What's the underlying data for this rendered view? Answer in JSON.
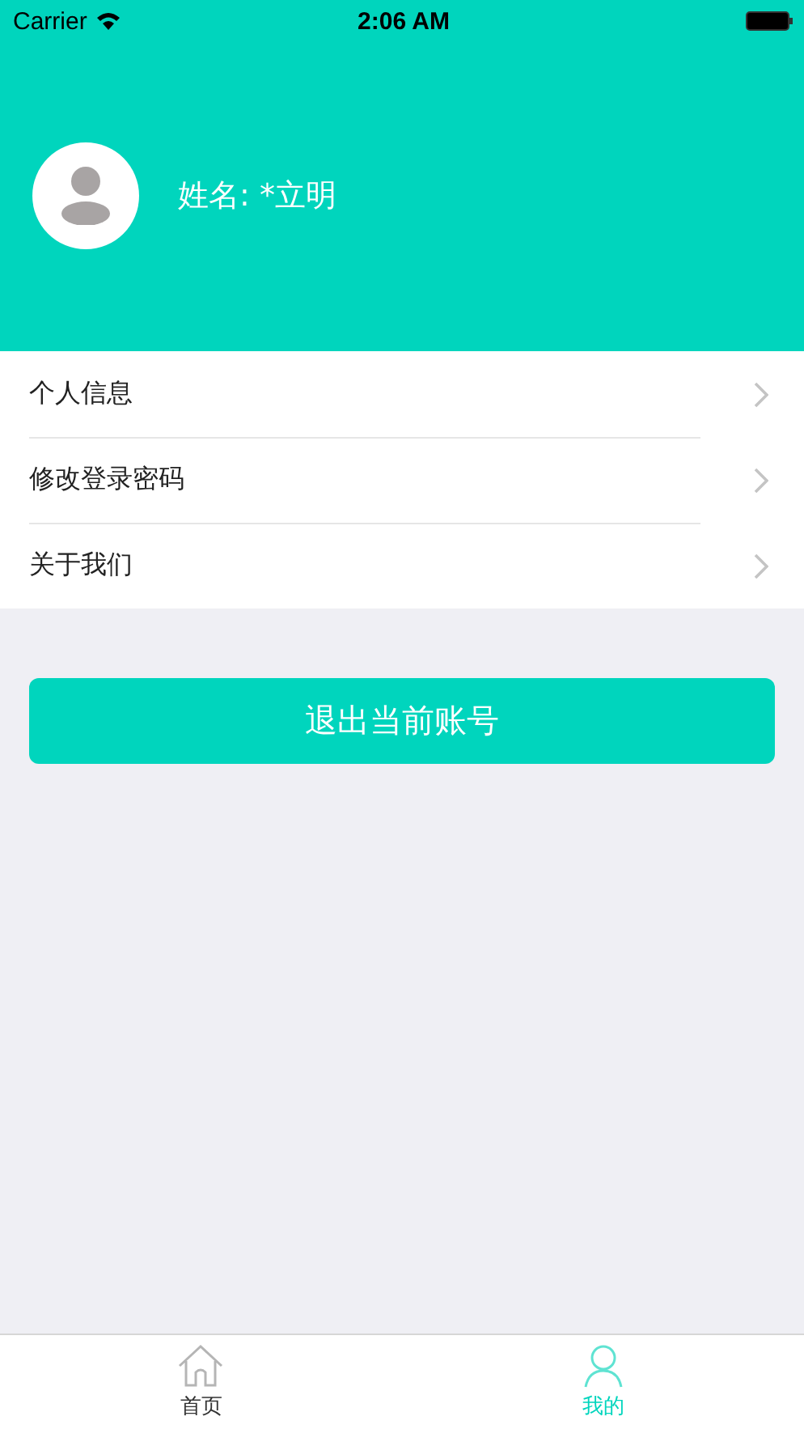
{
  "status_bar": {
    "carrier": "Carrier",
    "time": "2:06 AM"
  },
  "profile": {
    "name": "姓名: *立明"
  },
  "menu": [
    {
      "label": "个人信息"
    },
    {
      "label": "修改登录密码"
    },
    {
      "label": "关于我们"
    }
  ],
  "logout_button": "退出当前账号",
  "tabs": [
    {
      "label": "首页",
      "kind": "home",
      "selected": false
    },
    {
      "label": "我的",
      "kind": "person",
      "selected": true
    }
  ]
}
